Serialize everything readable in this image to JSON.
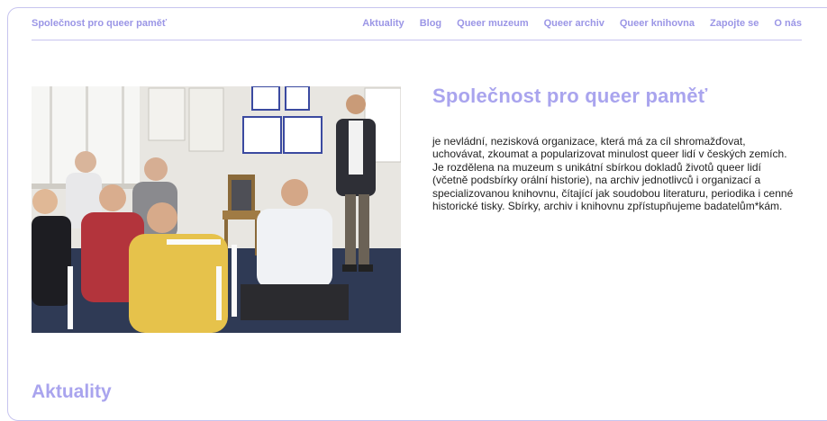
{
  "header": {
    "brand": "Společnost pro queer paměť",
    "nav": [
      "Aktuality",
      "Blog",
      "Queer muzeum",
      "Queer archiv",
      "Queer knihovna",
      "Zapojte se",
      "O nás"
    ]
  },
  "hero": {
    "title": "Společnost pro queer paměť",
    "text": "je nevládní, nezisková organizace, která má za cíl shromažďovat, uchovávat, zkoumat a popularizovat minulost queer lidí v českých zemích. Je rozdělena na muzeum s unikátní sbírkou dokladů životů queer lidí (včetně podsbírky orální historie), na archiv jednotlivců i organizací a specializovanou knihovnu, čítající jak soudobou literaturu, periodika i cenné historické tisky. Sbírky, archiv i knihovnu zpřístupňujeme badatelům*kám."
  },
  "sections": {
    "news_title": "Aktuality"
  },
  "colors": {
    "accent": "#a9a4ee",
    "nav": "#9b96e6",
    "border": "#c7c4ef"
  }
}
